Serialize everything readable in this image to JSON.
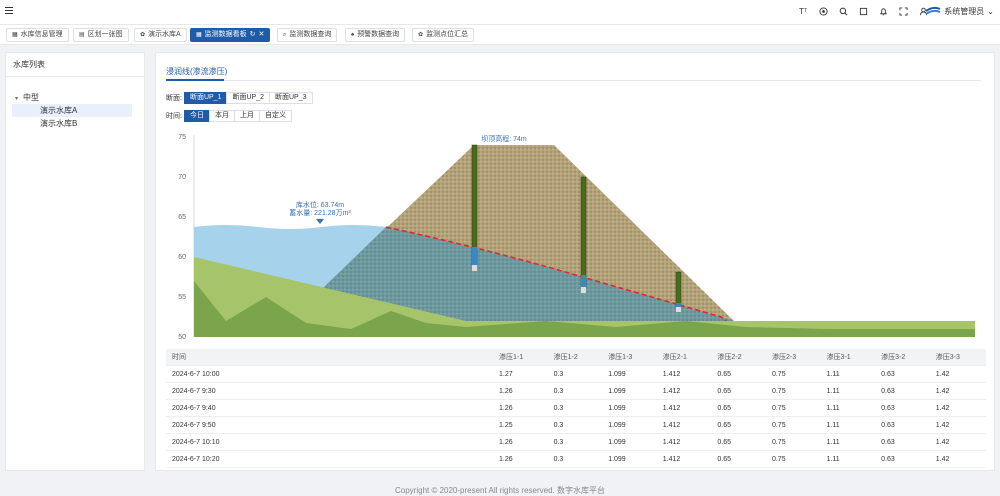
{
  "header": {
    "user_name": "系统管理员",
    "icons": [
      "font-size-icon",
      "github-icon",
      "search-icon",
      "fullscreen-icon",
      "bell-icon",
      "expand-icon",
      "user-icon"
    ]
  },
  "tabs": [
    {
      "label": "水库信息管理",
      "icon": "grid-icon",
      "active": false
    },
    {
      "label": "区划一张图",
      "icon": "map-icon",
      "active": false
    },
    {
      "label": "演示水库A",
      "icon": "gear-icon",
      "active": false
    },
    {
      "label": "监测数据看板",
      "icon": "grid-icon",
      "active": true
    },
    {
      "label": "监测数据查询",
      "icon": "search-icon",
      "active": false
    },
    {
      "label": "预警数据查询",
      "icon": "bell-icon",
      "active": false
    },
    {
      "label": "监测点位汇总",
      "icon": "gear-icon",
      "active": false
    }
  ],
  "sidebar": {
    "title": "水库列表",
    "group": "中型",
    "items": [
      "演示水库A",
      "演示水库B"
    ]
  },
  "panel": {
    "title": "浸润线(渗流渗压)",
    "section_label": "断面:",
    "sections": [
      "断面UP_1",
      "断面UP_2",
      "断面UP_3"
    ],
    "time_label": "时间:",
    "times": [
      "今日",
      "本月",
      "上月",
      "自定义"
    ]
  },
  "chart_data": {
    "type": "area",
    "y_ticks": [
      "75",
      "70",
      "65",
      "60",
      "55",
      "50"
    ],
    "ylim": [
      50,
      75
    ],
    "water_label_1": "库水位: 63.74m",
    "water_label_2": "蓄水量: 221.28万m³",
    "crest_label": "坝顶高程: 74m",
    "water_level": 63.74,
    "crest_elevation": 74,
    "colors": {
      "water": "#a6d2ec",
      "dam": "#b4a27a",
      "seepage": "#6f9aa0",
      "ground": "#a6c46a",
      "ground_dark": "#7aa54c",
      "phreatic": "#e8252a"
    }
  },
  "table": {
    "headers": [
      "时间",
      "渗压1-1",
      "渗压1-2",
      "渗压1-3",
      "渗压2-1",
      "渗压2-2",
      "渗压2-3",
      "渗压3-1",
      "渗压3-2",
      "渗压3-3"
    ],
    "rows": [
      [
        "2024-6-7 10:00",
        "1.27",
        "0.3",
        "1.099",
        "1.412",
        "0.65",
        "0.75",
        "1.11",
        "0.63",
        "1.42"
      ],
      [
        "2024-6-7 9:30",
        "1.26",
        "0.3",
        "1.099",
        "1.412",
        "0.65",
        "0.75",
        "1.11",
        "0.63",
        "1.42"
      ],
      [
        "2024-6-7 9:40",
        "1.26",
        "0.3",
        "1.099",
        "1.412",
        "0.65",
        "0.75",
        "1.11",
        "0.63",
        "1.42"
      ],
      [
        "2024-6-7 9:50",
        "1.25",
        "0.3",
        "1.099",
        "1.412",
        "0.65",
        "0.75",
        "1.11",
        "0.63",
        "1.42"
      ],
      [
        "2024-6-7 10:10",
        "1.26",
        "0.3",
        "1.099",
        "1.412",
        "0.65",
        "0.75",
        "1.11",
        "0.63",
        "1.42"
      ],
      [
        "2024-6-7 10:20",
        "1.26",
        "0.3",
        "1.099",
        "1.412",
        "0.65",
        "0.75",
        "1.11",
        "0.63",
        "1.42"
      ]
    ]
  },
  "footer": "Copyright © 2020-present All rights reserved. 数字水库平台"
}
